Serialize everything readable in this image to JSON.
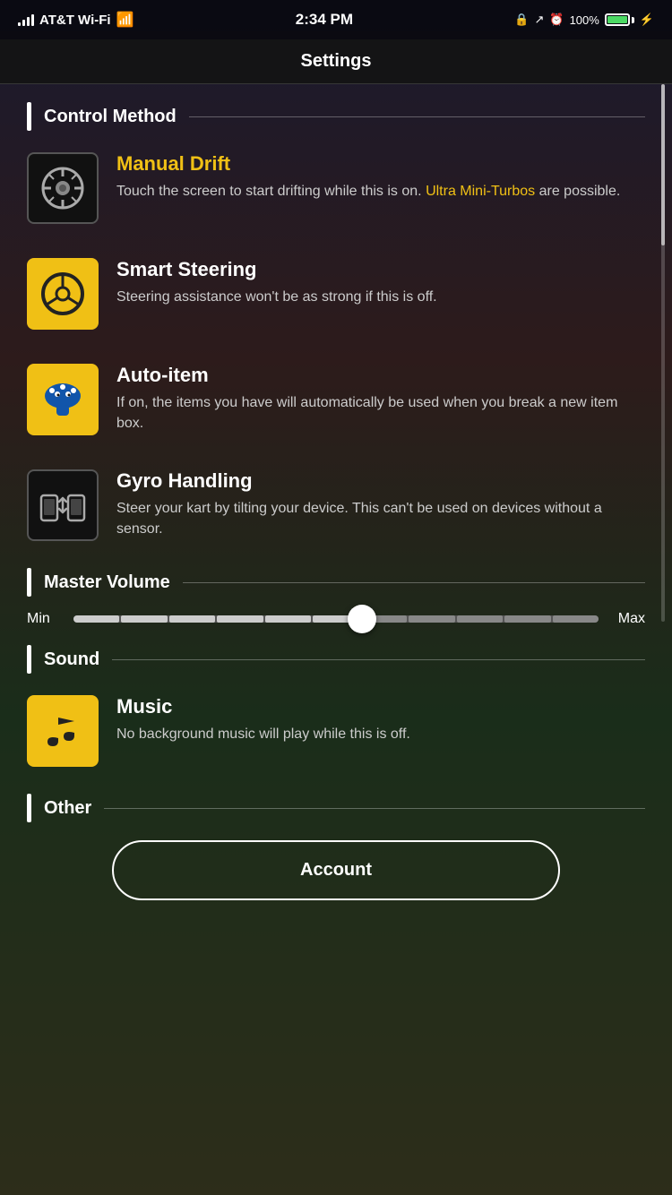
{
  "status_bar": {
    "carrier": "AT&T Wi-Fi",
    "time": "2:34 PM",
    "battery_percent": "100%"
  },
  "nav": {
    "title": "Settings"
  },
  "sections": {
    "control_method": {
      "label": "Control Method",
      "items": [
        {
          "id": "manual-drift",
          "name": "Manual Drift",
          "name_style": "yellow",
          "icon_style": "dark",
          "icon": "tire",
          "desc_parts": [
            {
              "text": "Touch the screen to start drifting while this is on. ",
              "highlight": false
            },
            {
              "text": "Ultra Mini-Turbos",
              "highlight": true
            },
            {
              "text": " are possible.",
              "highlight": false
            }
          ],
          "desc_plain": "Touch the screen to start drifting while this is on. Ultra Mini-Turbos are possible."
        },
        {
          "id": "smart-steering",
          "name": "Smart Steering",
          "name_style": "white",
          "icon_style": "yellow",
          "icon": "steering",
          "desc": "Steering assistance won't be as strong if this is off."
        },
        {
          "id": "auto-item",
          "name": "Auto-item",
          "name_style": "white",
          "icon_style": "yellow",
          "icon": "mushroom",
          "desc": "If on, the items you have will automatically be used when you break a new item box."
        },
        {
          "id": "gyro-handling",
          "name": "Gyro Handling",
          "name_style": "white",
          "icon_style": "dark",
          "icon": "gyro",
          "desc": "Steer your kart by tilting your device. This can't be used on devices without a sensor."
        }
      ]
    },
    "master_volume": {
      "label": "Master Volume",
      "min_label": "Min",
      "max_label": "Max",
      "value": 6,
      "total_segments": 11
    },
    "sound": {
      "label": "Sound",
      "items": [
        {
          "id": "music",
          "name": "Music",
          "name_style": "white",
          "icon_style": "yellow",
          "icon": "music",
          "desc": "No background music will play while this is off."
        }
      ]
    },
    "other": {
      "label": "Other",
      "buttons": [
        {
          "id": "account",
          "label": "Account"
        }
      ]
    }
  }
}
